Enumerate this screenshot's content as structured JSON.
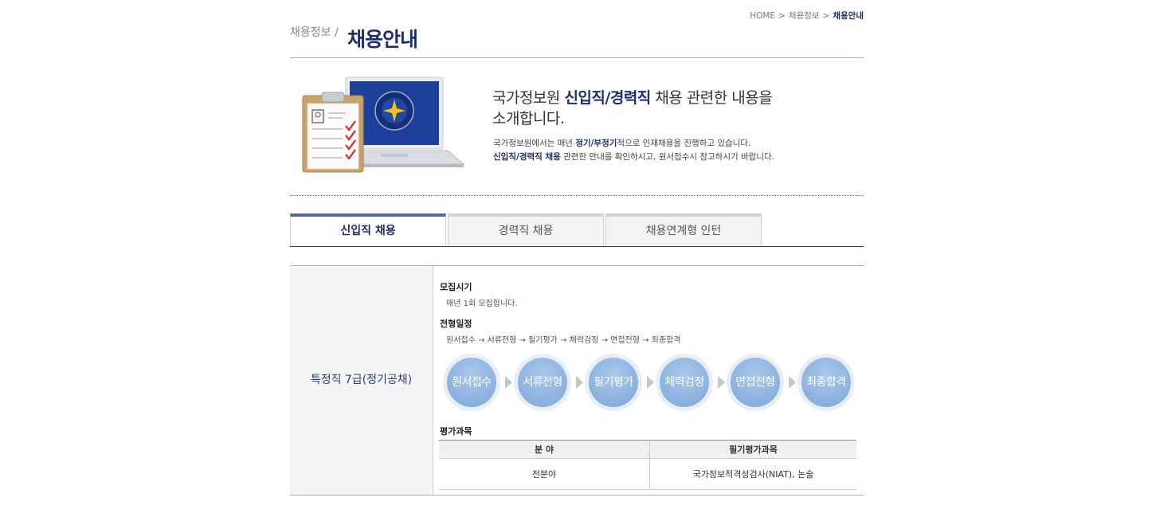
{
  "breadcrumb": {
    "home": "HOME",
    "sep": ">",
    "level1": "채용정보",
    "current": "채용안내"
  },
  "page_title": {
    "section": "채용정보 /",
    "main": "채용안내"
  },
  "intro": {
    "heading_pre": "국가정보원 ",
    "heading_strong": "신입직/경력직",
    "heading_post": " 채용 관련한 내용을",
    "heading_line2": "소개합니다.",
    "p1_pre": "국가정보원에서는 매년 ",
    "p1_strong": "정기/부정기",
    "p1_post": "적으로 인재채용을 진행하고 있습니다.",
    "p2_strong": "신입직/경력직 채용",
    "p2_post": " 관련한 안내를 확인하시고, 원서접수시 참고하시기 바랍니다."
  },
  "tabs": [
    {
      "label": "신입직 채용",
      "active": true
    },
    {
      "label": "경력직 채용",
      "active": false
    },
    {
      "label": "채용연계형 인턴",
      "active": false
    }
  ],
  "detail": {
    "category": "특정직 7급(정기공채)",
    "recruit_title": "모집시기",
    "recruit_text": "매년 1회 모집합니다.",
    "schedule_title": "전형일정",
    "schedule_text": "원서접수 → 서류전형 → 필기평가 → 체력검정 → 면접전형 → 최종합격",
    "steps": [
      "원서접수",
      "서류전형",
      "필기평가",
      "체력검정",
      "면접전형",
      "최종합격"
    ],
    "eval_title": "평가과목",
    "eval_headers": [
      "분 야",
      "필기평가과목"
    ],
    "eval_rows": [
      [
        "전분야",
        "국가정보적격성검사(NIAT), 논술"
      ]
    ]
  },
  "colors": {
    "brand_navy": "#1c2f6b",
    "step_blue": "#8fb4e0",
    "tab_active_bar": "#5667a0"
  }
}
